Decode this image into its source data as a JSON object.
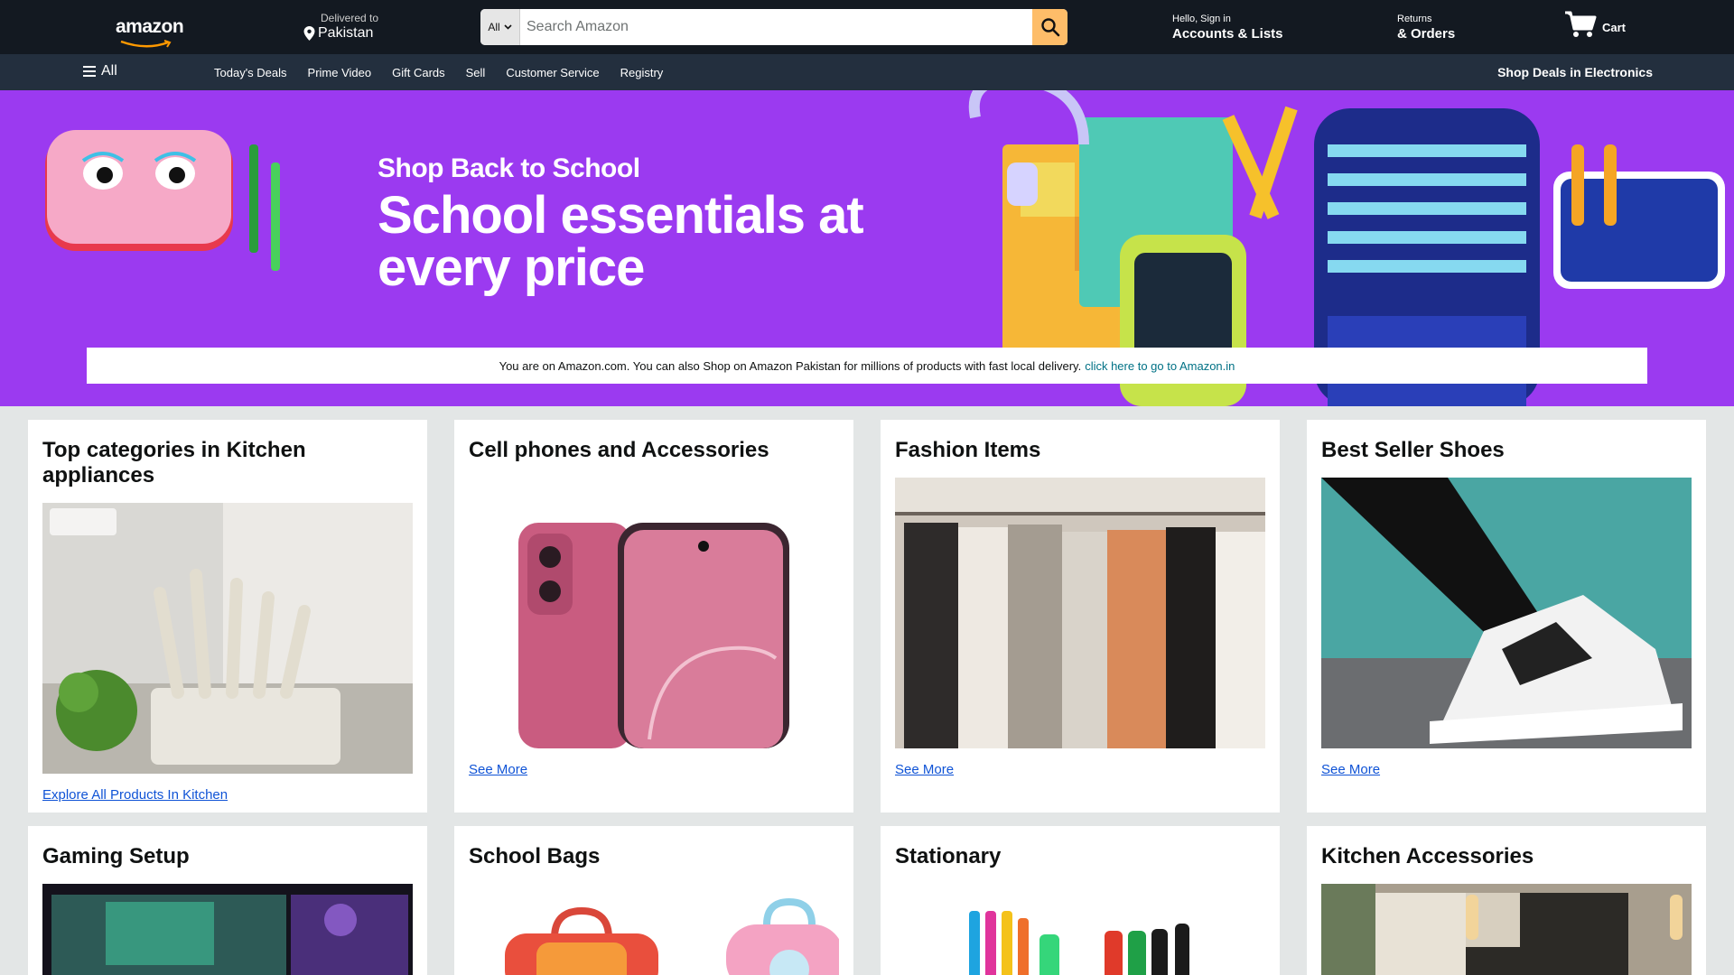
{
  "header": {
    "logo_text": "amazon",
    "deliver_label": "Delivered to",
    "deliver_location": "Pakistan",
    "search_category": "All",
    "search_placeholder": "Search Amazon",
    "account_greeting": "Hello, Sign in",
    "account_label": "Accounts & Lists",
    "returns_label": "Returns",
    "orders_label": "& Orders",
    "cart_label": "Cart"
  },
  "nav": {
    "all_label": "All",
    "links": [
      "Today's Deals",
      "Prime Video",
      "Gift Cards",
      "Sell",
      "Customer Service",
      "Registry"
    ],
    "right_link": "Shop Deals in Electronics"
  },
  "hero": {
    "eyebrow": "Shop Back to School",
    "title": "School essentials at every price",
    "notice_text": "You are on Amazon.com. You can also Shop on Amazon Pakistan for millions of products with fast local delivery.",
    "notice_link": "click here to go to Amazon.in"
  },
  "cards": [
    {
      "title": "Top categories in Kitchen appliances",
      "link": "Explore All Products In Kitchen"
    },
    {
      "title": "Cell phones and Accessories",
      "link": "See More"
    },
    {
      "title": "Fashion Items",
      "link": "See More"
    },
    {
      "title": "Best Seller Shoes",
      "link": "See More"
    },
    {
      "title": "Gaming Setup"
    },
    {
      "title": "School Bags"
    },
    {
      "title": "Stationary"
    },
    {
      "title": "Kitchen Accessories"
    }
  ],
  "colors": {
    "header_bg": "#131921",
    "nav_bg": "#232f3e",
    "search_button": "#febd69",
    "hero_bg": "#9b3af0",
    "link": "#0f53d6",
    "page_bg": "#e3e6e6"
  }
}
